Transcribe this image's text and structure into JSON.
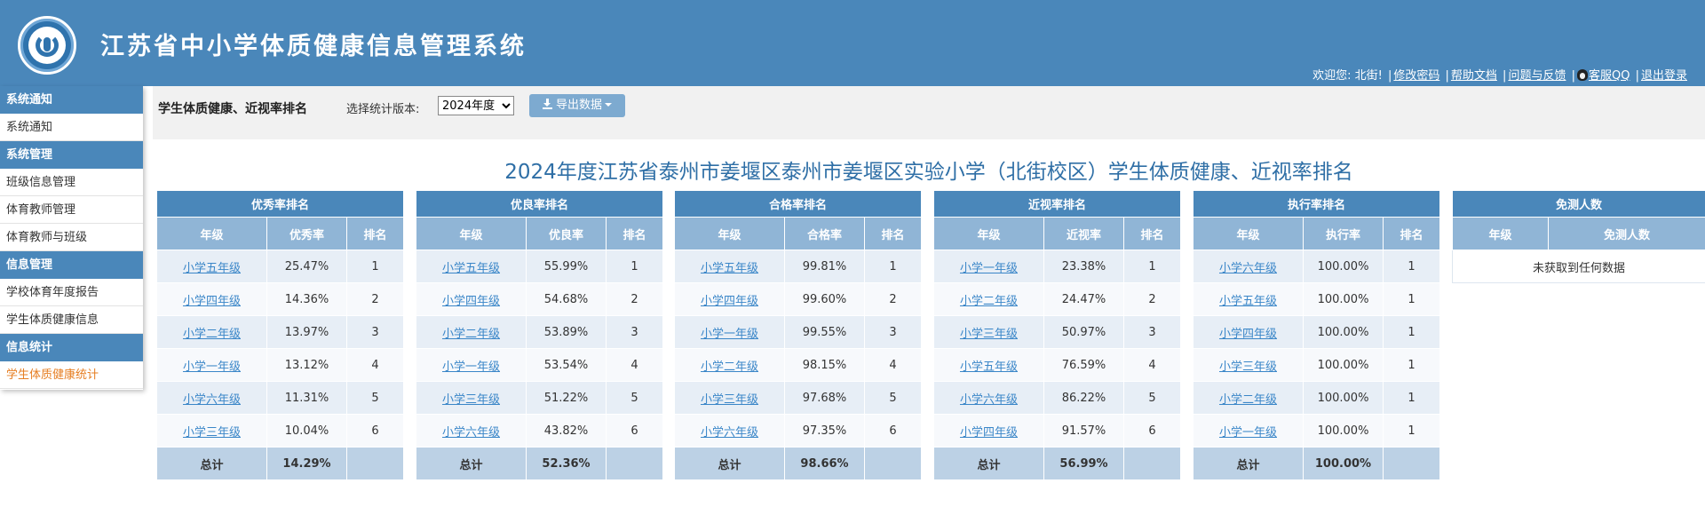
{
  "header": {
    "title": "江苏省中小学体质健康信息管理系统",
    "welcome": "欢迎您: 北街!",
    "links": [
      "修改密码",
      "帮助文档",
      "问题与反馈",
      "客服QQ",
      "退出登录"
    ]
  },
  "sidebar": {
    "groups": [
      {
        "title": "系统通知",
        "items": [
          "系统通知"
        ]
      },
      {
        "title": "系统管理",
        "items": [
          "班级信息管理",
          "体育教师管理",
          "体育教师与班级"
        ]
      },
      {
        "title": "信息管理",
        "items": [
          "学校体育年度报告",
          "学生体质健康信息"
        ]
      },
      {
        "title": "信息统计",
        "items": [
          "学生体质健康统计"
        ]
      }
    ],
    "active_item": "学生体质健康统计"
  },
  "toolbar": {
    "title": "学生体质健康、近视率排名",
    "version_label": "选择统计版本:",
    "version_value": "2024年度",
    "export_label": "导出数据"
  },
  "page_title": "2024年度江苏省泰州市姜堰区泰州市姜堰区实验小学（北街校区）学生体质健康、近视率排名",
  "tables": [
    {
      "caption": "优秀率排名",
      "headers": [
        "年级",
        "优秀率",
        "排名"
      ],
      "rows": [
        [
          "小学五年级",
          "25.47%",
          "1"
        ],
        [
          "小学四年级",
          "14.36%",
          "2"
        ],
        [
          "小学二年级",
          "13.97%",
          "3"
        ],
        [
          "小学一年级",
          "13.12%",
          "4"
        ],
        [
          "小学六年级",
          "11.31%",
          "5"
        ],
        [
          "小学三年级",
          "10.04%",
          "6"
        ]
      ],
      "total": [
        "总计",
        "14.29%",
        ""
      ]
    },
    {
      "caption": "优良率排名",
      "headers": [
        "年级",
        "优良率",
        "排名"
      ],
      "rows": [
        [
          "小学五年级",
          "55.99%",
          "1"
        ],
        [
          "小学四年级",
          "54.68%",
          "2"
        ],
        [
          "小学二年级",
          "53.89%",
          "3"
        ],
        [
          "小学一年级",
          "53.54%",
          "4"
        ],
        [
          "小学三年级",
          "51.22%",
          "5"
        ],
        [
          "小学六年级",
          "43.82%",
          "6"
        ]
      ],
      "total": [
        "总计",
        "52.36%",
        ""
      ]
    },
    {
      "caption": "合格率排名",
      "headers": [
        "年级",
        "合格率",
        "排名"
      ],
      "rows": [
        [
          "小学五年级",
          "99.81%",
          "1"
        ],
        [
          "小学四年级",
          "99.60%",
          "2"
        ],
        [
          "小学一年级",
          "99.55%",
          "3"
        ],
        [
          "小学二年级",
          "98.15%",
          "4"
        ],
        [
          "小学三年级",
          "97.68%",
          "5"
        ],
        [
          "小学六年级",
          "97.35%",
          "6"
        ]
      ],
      "total": [
        "总计",
        "98.66%",
        ""
      ]
    },
    {
      "caption": "近视率排名",
      "headers": [
        "年级",
        "近视率",
        "排名"
      ],
      "rows": [
        [
          "小学一年级",
          "23.38%",
          "1"
        ],
        [
          "小学二年级",
          "24.47%",
          "2"
        ],
        [
          "小学三年级",
          "50.97%",
          "3"
        ],
        [
          "小学五年级",
          "76.59%",
          "4"
        ],
        [
          "小学六年级",
          "86.22%",
          "5"
        ],
        [
          "小学四年级",
          "91.57%",
          "6"
        ]
      ],
      "total": [
        "总计",
        "56.99%",
        ""
      ]
    },
    {
      "caption": "执行率排名",
      "headers": [
        "年级",
        "执行率",
        "排名"
      ],
      "rows": [
        [
          "小学六年级",
          "100.00%",
          "1"
        ],
        [
          "小学五年级",
          "100.00%",
          "1"
        ],
        [
          "小学四年级",
          "100.00%",
          "1"
        ],
        [
          "小学三年级",
          "100.00%",
          "1"
        ],
        [
          "小学二年级",
          "100.00%",
          "1"
        ],
        [
          "小学一年级",
          "100.00%",
          "1"
        ]
      ],
      "total": [
        "总计",
        "100.00%",
        ""
      ]
    }
  ],
  "exempt_table": {
    "caption": "免测人数",
    "headers": [
      "年级",
      "免测人数"
    ],
    "empty_text": "未获取到任何数据"
  }
}
